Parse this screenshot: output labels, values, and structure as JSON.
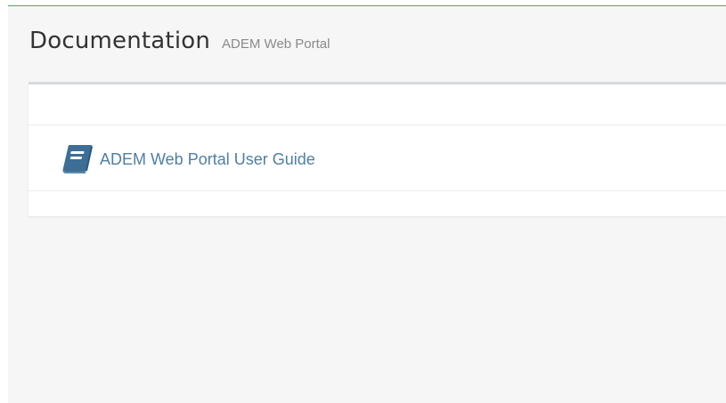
{
  "header": {
    "title": "Documentation",
    "subtitle": "ADEM Web Portal"
  },
  "documents": {
    "items": [
      {
        "label": "ADEM Web Portal User Guide",
        "icon": "book-icon"
      }
    ]
  },
  "colors": {
    "accent_line": "#4caf64",
    "link": "#4f7ea3",
    "icon": "#3c6e96",
    "page_background": "#f6f6f6",
    "panel_background": "#ffffff"
  }
}
